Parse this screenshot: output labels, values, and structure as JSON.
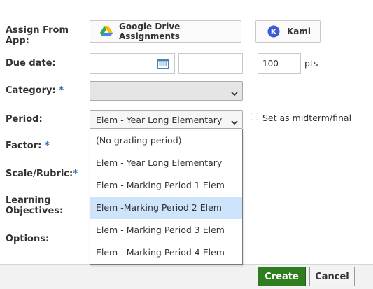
{
  "form": {
    "assign_from_app_label": "Assign From App:",
    "due_date_label": "Due date:",
    "category_label": "Category:",
    "period_label": "Period:",
    "factor_label": "Factor:",
    "scale_rubric_label": "Scale/Rubric:",
    "learning_objectives_label": "Learning Objectives:",
    "options_label": "Options:",
    "required_mark": "*"
  },
  "apps": {
    "google_drive_label": "Google Drive Assignments",
    "kami_label": "Kami",
    "kami_icon_letter": "K"
  },
  "due": {
    "date_value": "",
    "time_value": "",
    "points_value": "100",
    "points_unit": "pts"
  },
  "category": {
    "selected": ""
  },
  "period": {
    "selected": "Elem - Year Long Elementary",
    "options": [
      "(No grading period)",
      "Elem - Year Long Elementary",
      "Elem - Marking Period 1 Elem",
      "Elem -Marking Period 2 Elem",
      "Elem - Marking Period 3 Elem",
      "Elem - Marking Period 4 Elem"
    ],
    "highlighted_index": 3,
    "midterm_label": "Set as midterm/final",
    "midterm_checked": false
  },
  "actions": {
    "create_label": "Create",
    "cancel_label": "Cancel"
  },
  "colors": {
    "accent_blue": "#2f6ab5",
    "create_green": "#2e7d1f",
    "highlight": "#cde4fb",
    "kami_blue": "#3b5bd6"
  }
}
